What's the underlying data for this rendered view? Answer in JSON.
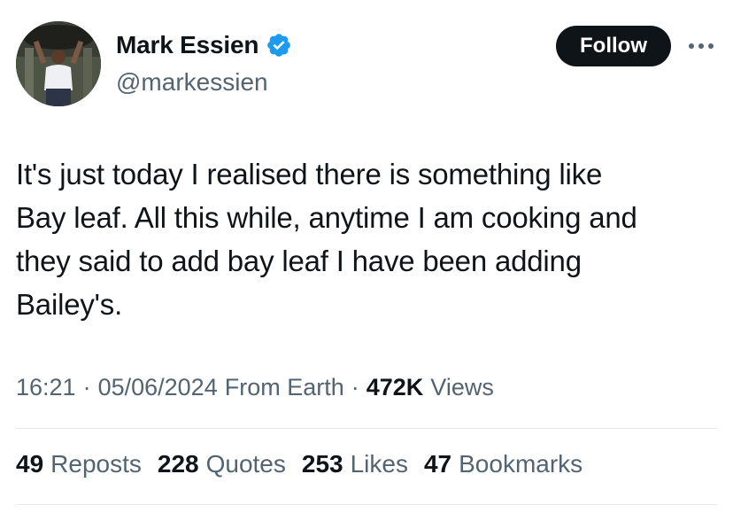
{
  "author": {
    "display_name": "Mark Essien",
    "handle": "@markessien",
    "verified_icon": "verified-badge-icon",
    "verified_color": "#1d9bf0"
  },
  "actions": {
    "follow_label": "Follow",
    "more_icon": "more-horizontal-icon"
  },
  "tweet": {
    "text": "It's just today I realised there is something like\nBay leaf. All this while, anytime I am cooking and\nthey said to add bay leaf I have been adding\nBailey's."
  },
  "meta": {
    "time": "16:21",
    "separator": "·",
    "date": "05/06/2024",
    "source": "From Earth",
    "views_count": "472K",
    "views_label": "Views"
  },
  "stats": [
    {
      "count": "49",
      "label": "Reposts"
    },
    {
      "count": "228",
      "label": "Quotes"
    },
    {
      "count": "253",
      "label": "Likes"
    },
    {
      "count": "47",
      "label": "Bookmarks"
    }
  ],
  "colors": {
    "text_primary": "#0f1419",
    "text_secondary": "#536471",
    "button_bg": "#0f1419",
    "divider": "#e6e9eb"
  }
}
